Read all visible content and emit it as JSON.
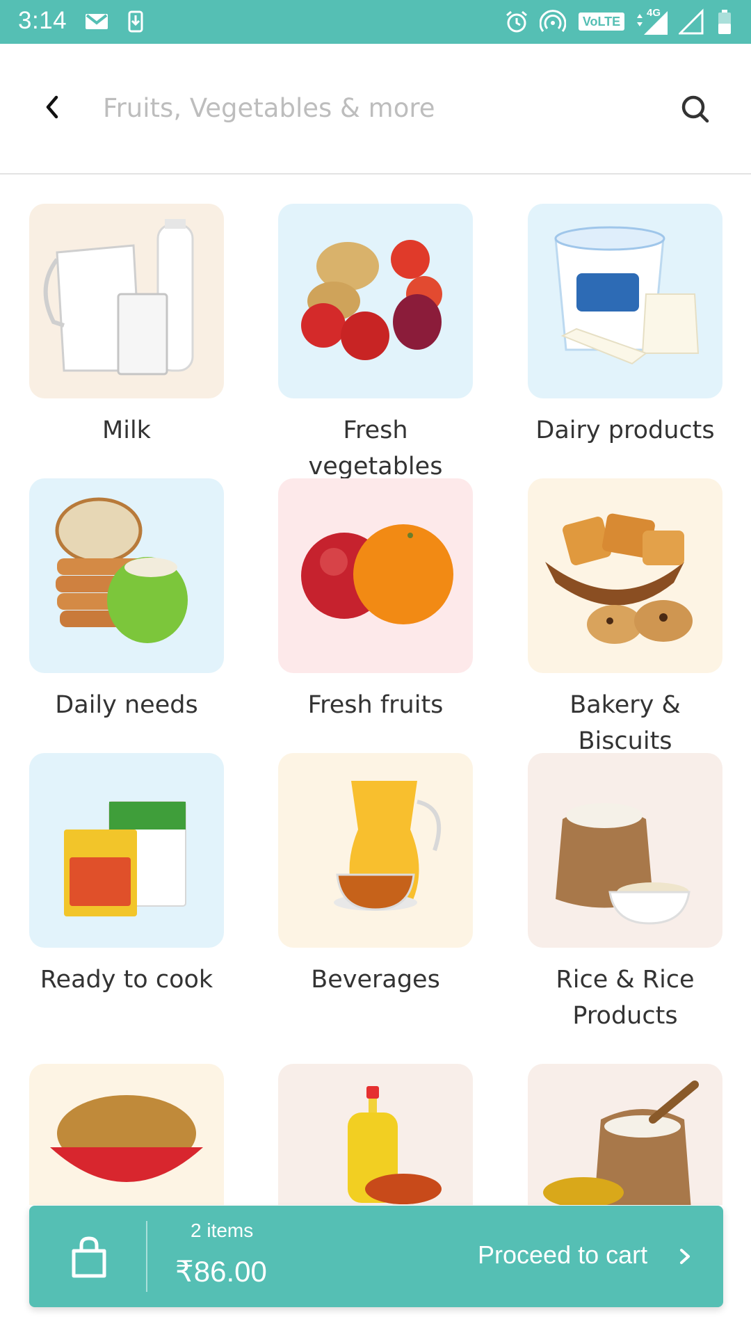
{
  "status_bar": {
    "time": "3:14",
    "network_label": "VoLTE",
    "network_type": "4G",
    "icons": [
      "gmail-icon",
      "download-icon",
      "alarm-icon",
      "hotspot-icon",
      "volte-icon",
      "signal-4g-icon",
      "signal-icon",
      "battery-icon"
    ]
  },
  "search": {
    "placeholder": "Fruits, Vegetables & more",
    "value": ""
  },
  "categories": [
    {
      "label": "Milk",
      "icon": "milk-image",
      "bg": "#f9efe3"
    },
    {
      "label": "Fresh vegetables",
      "icon": "vegetables-image",
      "bg": "#e2f3fb"
    },
    {
      "label": "Dairy products",
      "icon": "dairy-image",
      "bg": "#e2f3fb"
    },
    {
      "label": "Daily needs",
      "icon": "daily-needs-image",
      "bg": "#e2f3fb"
    },
    {
      "label": "Fresh fruits",
      "icon": "fruits-image",
      "bg": "#fde9ea"
    },
    {
      "label": "Bakery & Biscuits",
      "icon": "bakery-image",
      "bg": "#fdf4e4"
    },
    {
      "label": "Ready to cook",
      "icon": "ready-to-cook-image",
      "bg": "#e2f3fb"
    },
    {
      "label": "Beverages",
      "icon": "beverages-image",
      "bg": "#fdf4e4"
    },
    {
      "label": "Rice & Rice Products",
      "icon": "rice-image",
      "bg": "#f8eee9"
    },
    {
      "label": "",
      "icon": "snacks-image",
      "bg": "#fdf4e4"
    },
    {
      "label": "",
      "icon": "oil-masala-image",
      "bg": "#f8eee9"
    },
    {
      "label": "",
      "icon": "atta-flour-image",
      "bg": "#f8eee9"
    }
  ],
  "cart": {
    "items_label": "2 items",
    "total": "₹86.00",
    "cta": "Proceed to cart"
  },
  "colors": {
    "accent": "#55bfb4"
  }
}
